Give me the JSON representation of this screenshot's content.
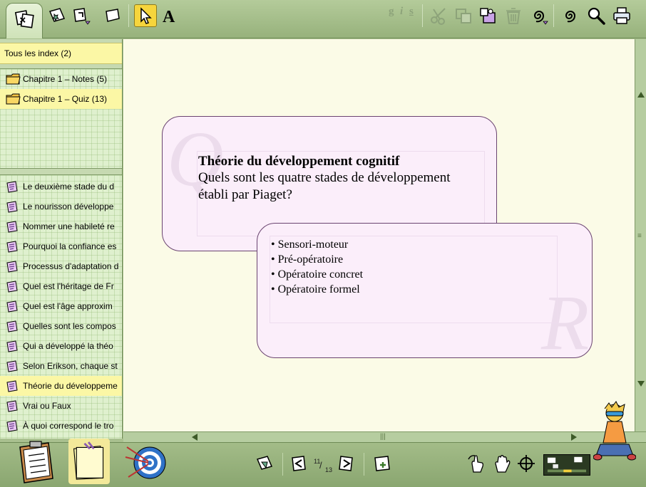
{
  "toolbar": {
    "format_bold": "g",
    "format_italic": "i",
    "format_underline": "s"
  },
  "sidebar": {
    "all_index": "Tous les index (2)",
    "chapters": [
      {
        "label": "Chapitre 1 – Notes (5)"
      },
      {
        "label": "Chapitre 1 – Quiz (13)"
      }
    ],
    "cards": [
      {
        "label": "Le deuxième stade du d"
      },
      {
        "label": "Le nourisson développe"
      },
      {
        "label": "Nommer une habileté re"
      },
      {
        "label": "Pourquoi la confiance es"
      },
      {
        "label": "Processus d'adaptation d"
      },
      {
        "label": "Quel est l'héritage de Fr"
      },
      {
        "label": "Quel est l'âge approxim"
      },
      {
        "label": "Quelles sont les compos"
      },
      {
        "label": "Qui a développé la théo"
      },
      {
        "label": "Selon Erikson, chaque st"
      },
      {
        "label": "Théorie du développeme"
      },
      {
        "label": "Vrai ou Faux"
      },
      {
        "label": "À quoi correspond le tro"
      }
    ]
  },
  "card": {
    "question_watermark": "Q",
    "answer_watermark": "R",
    "title": "Théorie du développement cognitif",
    "question": "Quels sont les quatre stades de développement établi par Piaget?",
    "answers": [
      "• Sensori-moteur",
      "• Pré-opératoire",
      "• Opératoire concret",
      "• Opératoire formel"
    ]
  },
  "pager": {
    "current": "11",
    "total": "13"
  },
  "colors": {
    "accent_yellow": "#fbf7a5",
    "card_fill": "#fbeefa",
    "card_border": "#6a4470",
    "toolbar_green": "#a9c08f"
  }
}
